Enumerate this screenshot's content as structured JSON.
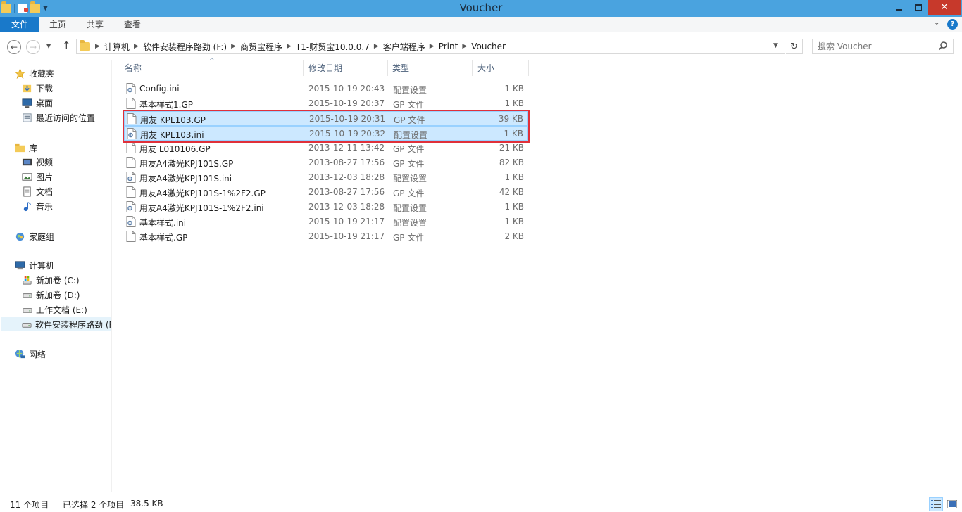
{
  "window": {
    "title": "Voucher",
    "titlebar_color": "#4aa3df",
    "close_color": "#c7392b"
  },
  "ribbon": {
    "file_tab": "文件",
    "tabs": [
      "主页",
      "共享",
      "查看"
    ],
    "accent": "#1979ca"
  },
  "address": {
    "crumbs": [
      "计算机",
      "软件安装程序路劲 (F:)",
      "商贸宝程序",
      "T1-财贸宝10.0.0.7",
      "客户端程序",
      "Print",
      "Voucher"
    ],
    "search_placeholder": "搜索 Voucher"
  },
  "nav": {
    "favorites": {
      "label": "收藏夹",
      "items": [
        "下载",
        "桌面",
        "最近访问的位置"
      ]
    },
    "libraries": {
      "label": "库",
      "items": [
        "视频",
        "图片",
        "文档",
        "音乐"
      ]
    },
    "homegroup": "家庭组",
    "computer": {
      "label": "计算机",
      "items": [
        "新加卷 (C:)",
        "新加卷 (D:)",
        "工作文档 (E:)",
        "软件安装程序路劲 (F:)"
      ]
    },
    "network": "网络"
  },
  "columns": {
    "name": "名称",
    "modified": "修改日期",
    "type": "类型",
    "size": "大小"
  },
  "files": [
    {
      "name": "Config.ini",
      "modified": "2015-10-19 20:43",
      "type": "配置设置",
      "size": "1 KB",
      "icon": "settings-file-icon",
      "selected": false
    },
    {
      "name": "基本样式1.GP",
      "modified": "2015-10-19 20:37",
      "type": "GP 文件",
      "size": "1 KB",
      "icon": "blank-file-icon",
      "selected": false
    },
    {
      "name": "用友 KPL103.GP",
      "modified": "2015-10-19 20:31",
      "type": "GP 文件",
      "size": "39 KB",
      "icon": "blank-file-icon",
      "selected": true
    },
    {
      "name": "用友 KPL103.ini",
      "modified": "2015-10-19 20:32",
      "type": "配置设置",
      "size": "1 KB",
      "icon": "settings-file-icon",
      "selected": true
    },
    {
      "name": "用友 L010106.GP",
      "modified": "2013-12-11 13:42",
      "type": "GP 文件",
      "size": "21 KB",
      "icon": "blank-file-icon",
      "selected": false
    },
    {
      "name": "用友A4激光KPJ101S.GP",
      "modified": "2013-08-27 17:56",
      "type": "GP 文件",
      "size": "82 KB",
      "icon": "blank-file-icon",
      "selected": false
    },
    {
      "name": "用友A4激光KPJ101S.ini",
      "modified": "2013-12-03 18:28",
      "type": "配置设置",
      "size": "1 KB",
      "icon": "settings-file-icon",
      "selected": false
    },
    {
      "name": "用友A4激光KPJ101S-1%2F2.GP",
      "modified": "2013-08-27 17:56",
      "type": "GP 文件",
      "size": "42 KB",
      "icon": "blank-file-icon",
      "selected": false
    },
    {
      "name": "用友A4激光KPJ101S-1%2F2.ini",
      "modified": "2013-12-03 18:28",
      "type": "配置设置",
      "size": "1 KB",
      "icon": "settings-file-icon",
      "selected": false
    },
    {
      "name": "基本样式.ini",
      "modified": "2015-10-19 21:17",
      "type": "配置设置",
      "size": "1 KB",
      "icon": "settings-file-icon",
      "selected": false
    },
    {
      "name": "基本样式.GP",
      "modified": "2015-10-19 21:17",
      "type": "GP 文件",
      "size": "2 KB",
      "icon": "blank-file-icon",
      "selected": false
    }
  ],
  "status": {
    "count": "11 个项目",
    "selection": "已选择 2 个项目",
    "selection_size": "38.5 KB"
  },
  "colors": {
    "selection_fill": "#cce8ff",
    "selection_border": "#99d1ff",
    "highlight_box": "#e0303a"
  }
}
